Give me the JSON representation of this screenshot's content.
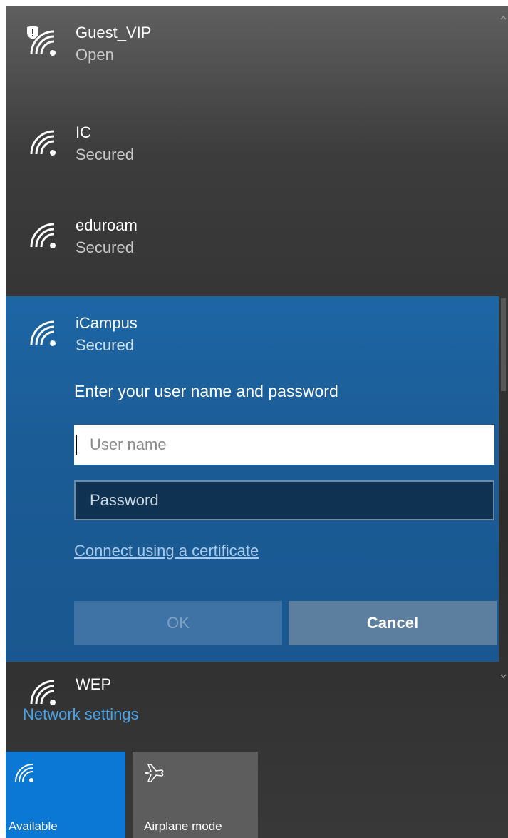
{
  "networks": [
    {
      "name": "Guest_VIP",
      "status": "Open",
      "icon": "wifi-open-shield-icon"
    },
    {
      "name": "IC",
      "status": "Secured",
      "icon": "wifi-icon"
    },
    {
      "name": "eduroam",
      "status": "Secured",
      "icon": "wifi-icon"
    },
    {
      "name": "iCampus",
      "status": "Secured",
      "icon": "wifi-icon"
    },
    {
      "name": "WEP",
      "status": "",
      "icon": "wifi-icon"
    }
  ],
  "login": {
    "prompt": "Enter your user name and password",
    "username_placeholder": "User name",
    "password_placeholder": "Password",
    "certificate_link": "Connect using a certificate",
    "ok_label": "OK",
    "cancel_label": "Cancel"
  },
  "network_settings": "Network settings",
  "quick_actions": [
    {
      "label": "Available",
      "icon": "wifi-icon",
      "active": true
    },
    {
      "label": "Airplane mode",
      "icon": "airplane-icon",
      "active": false
    }
  ],
  "colors": {
    "selected_bg": "#1b5c96",
    "accent": "#0a78d4",
    "link": "#4aa3e8"
  }
}
